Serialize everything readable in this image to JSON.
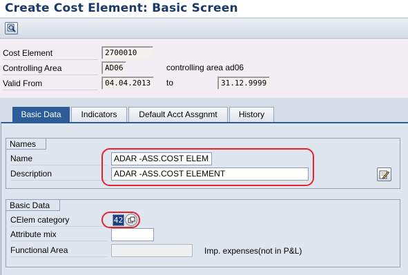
{
  "window": {
    "title": "Create Cost Element: Basic Screen"
  },
  "toolbar": {
    "icon": "master-data-icon"
  },
  "header": {
    "cost_element_label": "Cost Element",
    "cost_element_value": "2700010",
    "controlling_area_label": "Controlling Area",
    "controlling_area_value": "AD06",
    "controlling_area_text": "controlling area ad06",
    "valid_from_label": "Valid From",
    "valid_from_value": "04.04.2013",
    "to_label": "to",
    "valid_to_value": "31.12.9999"
  },
  "tabs": [
    {
      "label": "Basic Data",
      "active": true
    },
    {
      "label": "Indicators",
      "active": false
    },
    {
      "label": "Default Acct Assgnmt",
      "active": false
    },
    {
      "label": "History",
      "active": false
    }
  ],
  "names_group": {
    "title": "Names",
    "name_label": "Name",
    "name_value": "ADAR -ASS.COST ELEM",
    "description_label": "Description",
    "description_value": "ADAR -ASS.COST ELEMENT"
  },
  "basic_data_group": {
    "title": "Basic Data",
    "category_label": "CElem category",
    "category_value": "42",
    "attribute_mix_label": "Attribute mix",
    "attribute_mix_value": "",
    "functional_area_label": "Functional Area",
    "functional_area_value": "",
    "category_text": "Imp. expenses(not in P&L)"
  },
  "colors": {
    "active_tab": "#2d5d96",
    "highlight": "#e8202c",
    "title": "#1b3a6b"
  }
}
